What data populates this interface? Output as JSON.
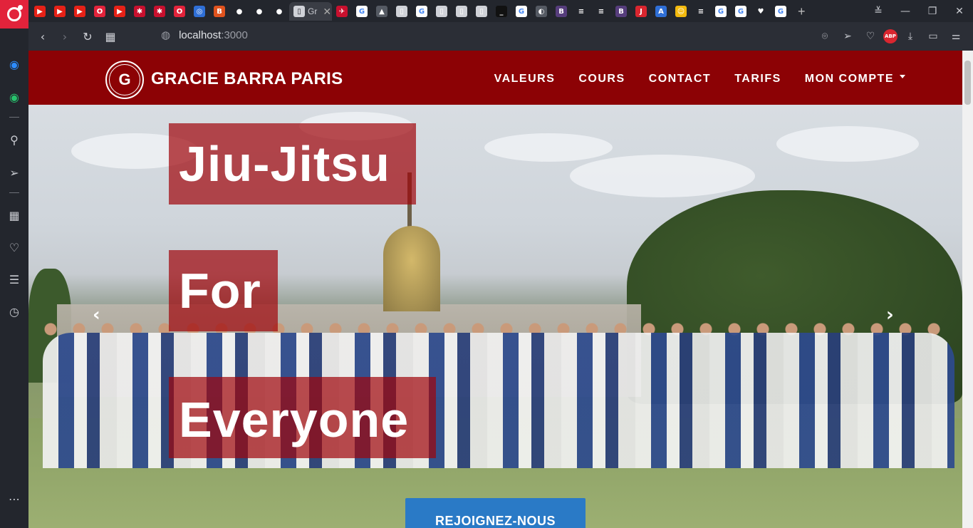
{
  "browser": {
    "tabs": [
      {
        "icon": "youtube-icon",
        "color": "#e62117",
        "glyph": "▶"
      },
      {
        "icon": "youtube-icon",
        "color": "#e62117",
        "glyph": "▶"
      },
      {
        "icon": "youtube-icon",
        "color": "#e62117",
        "glyph": "▶"
      },
      {
        "icon": "opera-icon",
        "color": "#e2233b",
        "glyph": "O"
      },
      {
        "icon": "youtube-icon",
        "color": "#e62117",
        "glyph": "▶"
      },
      {
        "icon": "app-red-icon",
        "color": "#c8102e",
        "glyph": "✱"
      },
      {
        "icon": "app-red-icon",
        "color": "#c8102e",
        "glyph": "✱"
      },
      {
        "icon": "opera-icon",
        "color": "#e2233b",
        "glyph": "O"
      },
      {
        "icon": "circle-app-icon",
        "color": "#2f6fd6",
        "glyph": "◎"
      },
      {
        "icon": "orange-app-icon",
        "color": "#e0531e",
        "glyph": "B"
      },
      {
        "icon": "github-icon",
        "color": "#23262d",
        "glyph": "●"
      },
      {
        "icon": "github-icon",
        "color": "#23262d",
        "glyph": "●"
      },
      {
        "icon": "github-icon",
        "color": "#23262d",
        "glyph": "●"
      }
    ],
    "active_tab": {
      "title": "Gr",
      "icon": "page-icon"
    },
    "tabs_after": [
      {
        "icon": "red-bird-icon",
        "color": "#c8102e",
        "glyph": "✈"
      },
      {
        "icon": "google-icon",
        "color": "#ffffff",
        "glyph": "G"
      },
      {
        "icon": "lock-page-icon",
        "color": "#555a63",
        "glyph": "▲"
      },
      {
        "icon": "page-icon",
        "color": "#d0d2d8",
        "glyph": "▯"
      },
      {
        "icon": "google-icon",
        "color": "#ffffff",
        "glyph": "G"
      },
      {
        "icon": "page-icon",
        "color": "#d0d2d8",
        "glyph": "▯"
      },
      {
        "icon": "page-icon",
        "color": "#d0d2d8",
        "glyph": "▯"
      },
      {
        "icon": "page-icon",
        "color": "#d0d2d8",
        "glyph": "▯"
      },
      {
        "icon": "terminal-icon",
        "color": "#111111",
        "glyph": "_"
      },
      {
        "icon": "google-icon",
        "color": "#ffffff",
        "glyph": "G"
      },
      {
        "icon": "gray-app-icon",
        "color": "#555a63",
        "glyph": "◐"
      },
      {
        "icon": "bootstrap-icon",
        "color": "#563d7c",
        "glyph": "B"
      },
      {
        "icon": "stackoverflow-icon",
        "color": "#23262d",
        "glyph": "≡"
      },
      {
        "icon": "stackoverflow-icon",
        "color": "#23262d",
        "glyph": "≡"
      },
      {
        "icon": "bootstrap-icon",
        "color": "#563d7c",
        "glyph": "B"
      },
      {
        "icon": "j-app-icon",
        "color": "#d9262f",
        "glyph": "J"
      },
      {
        "icon": "a-app-icon",
        "color": "#2f6fd6",
        "glyph": "A"
      },
      {
        "icon": "yellow-app-icon",
        "color": "#f2b90d",
        "glyph": "☺"
      },
      {
        "icon": "stackoverflow-icon",
        "color": "#23262d",
        "glyph": "≡"
      },
      {
        "icon": "google-icon",
        "color": "#ffffff",
        "glyph": "G"
      },
      {
        "icon": "google-icon",
        "color": "#ffffff",
        "glyph": "G"
      },
      {
        "icon": "heart-app-icon",
        "color": "#23262d",
        "glyph": "♥"
      },
      {
        "icon": "google-icon",
        "color": "#ffffff",
        "glyph": "G"
      }
    ],
    "url_host": "localhost",
    "url_port": ":3000"
  },
  "site": {
    "brand": "GRACIE BARRA PARIS",
    "logo_letter": "G",
    "menu": {
      "valeurs": "VALEURS",
      "cours": "COURS",
      "contact": "CONTACT",
      "tarifs": "TARIFS",
      "compte": "MON COMPTE"
    },
    "hero": {
      "line1": "Jiu-Jitsu",
      "line2": "For",
      "line3": "Everyone",
      "cta": "REJOIGNEZ-NOUS"
    },
    "colors": {
      "header": "#8c0205",
      "overlay": "#a0040a",
      "cta": "#2a7ac6"
    }
  }
}
